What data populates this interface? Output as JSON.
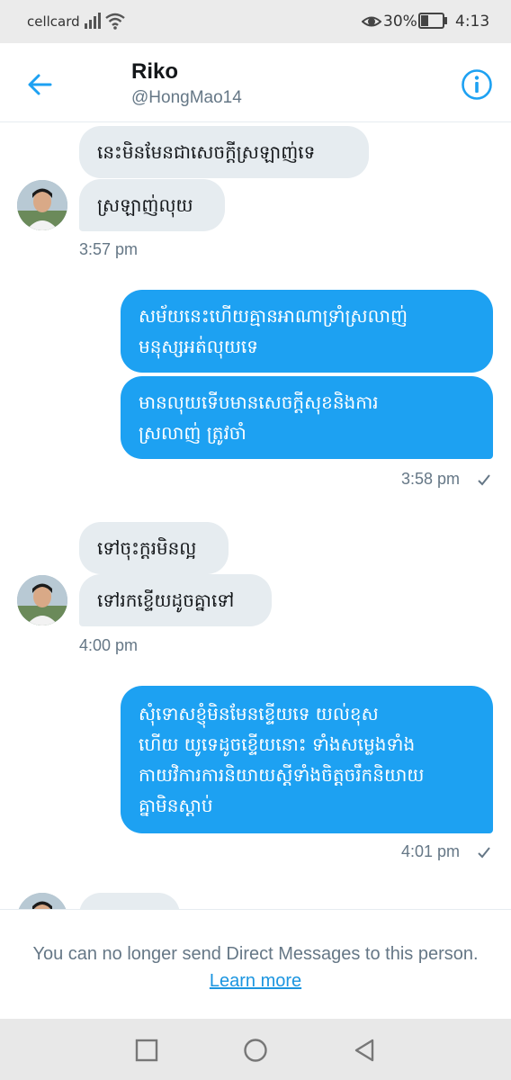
{
  "status_bar": {
    "carrier": "cellcard",
    "battery": "30%",
    "time": "4:13"
  },
  "header": {
    "name": "Riko",
    "handle": "@HongMao14"
  },
  "messages": {
    "in1": {
      "text": "នេះមិនមែនជាសេចក្ដីស្រឡាញ់ទេ"
    },
    "in2": {
      "text": "ស្រឡាញ់លុយ"
    },
    "time1": "3:57 pm",
    "out1": {
      "line1": "សម័យនេះហើយគ្មានអាណាទ្រាំស្រលាញ់",
      "line2": "មនុស្សអត់លុយទេ"
    },
    "out2": {
      "line1": "មានលុយទើបមានសេចក្ដីសុខនិងការ",
      "line2": "ស្រលាញ់ ត្រូវចាំ"
    },
    "time2": "3:58 pm",
    "in3": {
      "text": "ទៅចុះក្ដរមិនល្អ"
    },
    "in4": {
      "text": "ទៅរកខ្ទើយដូចគ្នាទៅ"
    },
    "time3": "4:00 pm",
    "out3": {
      "line1": "សុំទោសខ្ញុំមិនមែនខ្ទើយទេ យល់ខុស",
      "line2": "ហើយ យូទេដូចខ្ទើយនោះ ទាំងសម្លេងទាំង",
      "line3": "កាយវិការការនិយាយស្ដីទាំងចិត្តចរឹកនិយាយ",
      "line4": "គ្នាមិនស្ដាប់"
    },
    "time4": "4:01 pm"
  },
  "footer": {
    "notice": "You can no longer send Direct Messages to this person.",
    "link": "Learn more"
  },
  "colors": {
    "accent": "#1da1f2",
    "incoming_bubble": "#e6ecf0",
    "muted": "#657786"
  },
  "icons": {
    "back": "arrow-left-icon",
    "info": "info-circle-icon",
    "read": "check-icon"
  }
}
